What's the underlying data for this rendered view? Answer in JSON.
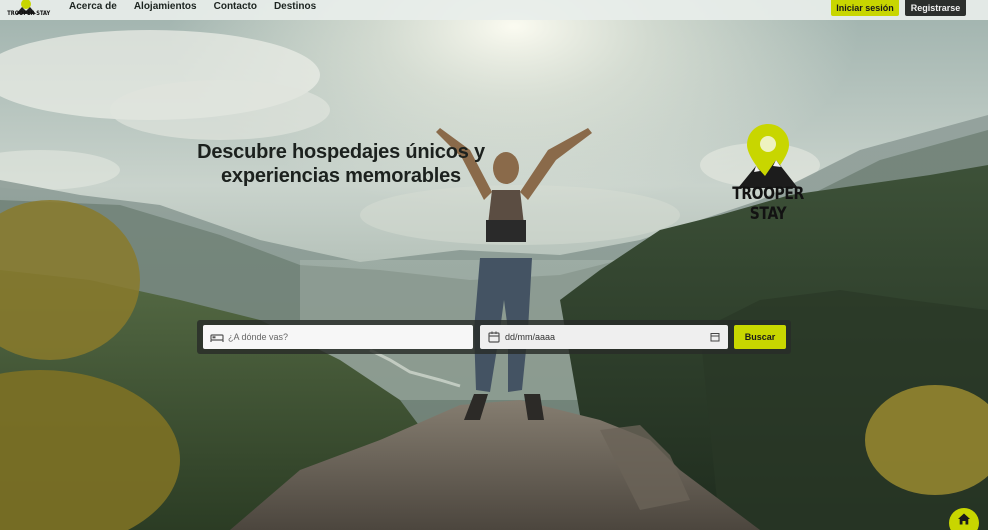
{
  "nav": {
    "logo_text": "TROOPER STAY",
    "links": [
      "Acerca de",
      "Alojamientos",
      "Contacto",
      "Destinos"
    ],
    "login_label": "Iniciar sesión",
    "register_label": "Registrarse"
  },
  "hero": {
    "title_line1": "Descubre hospedajes únicos y",
    "title_line2": "experiencias memorables"
  },
  "brand": {
    "name": "TROOPER STAY"
  },
  "search": {
    "destination_placeholder": "¿A dónde vas?",
    "date_value": "dd/mm/aaaa",
    "button_label": "Buscar"
  },
  "colors": {
    "accent": "#c8d600",
    "dark_button": "#2c2f2d",
    "navbar_bg": "#e8eeea"
  },
  "icons": {
    "destination": "bed-icon",
    "date": "calendar-icon",
    "fab": "home-icon"
  }
}
